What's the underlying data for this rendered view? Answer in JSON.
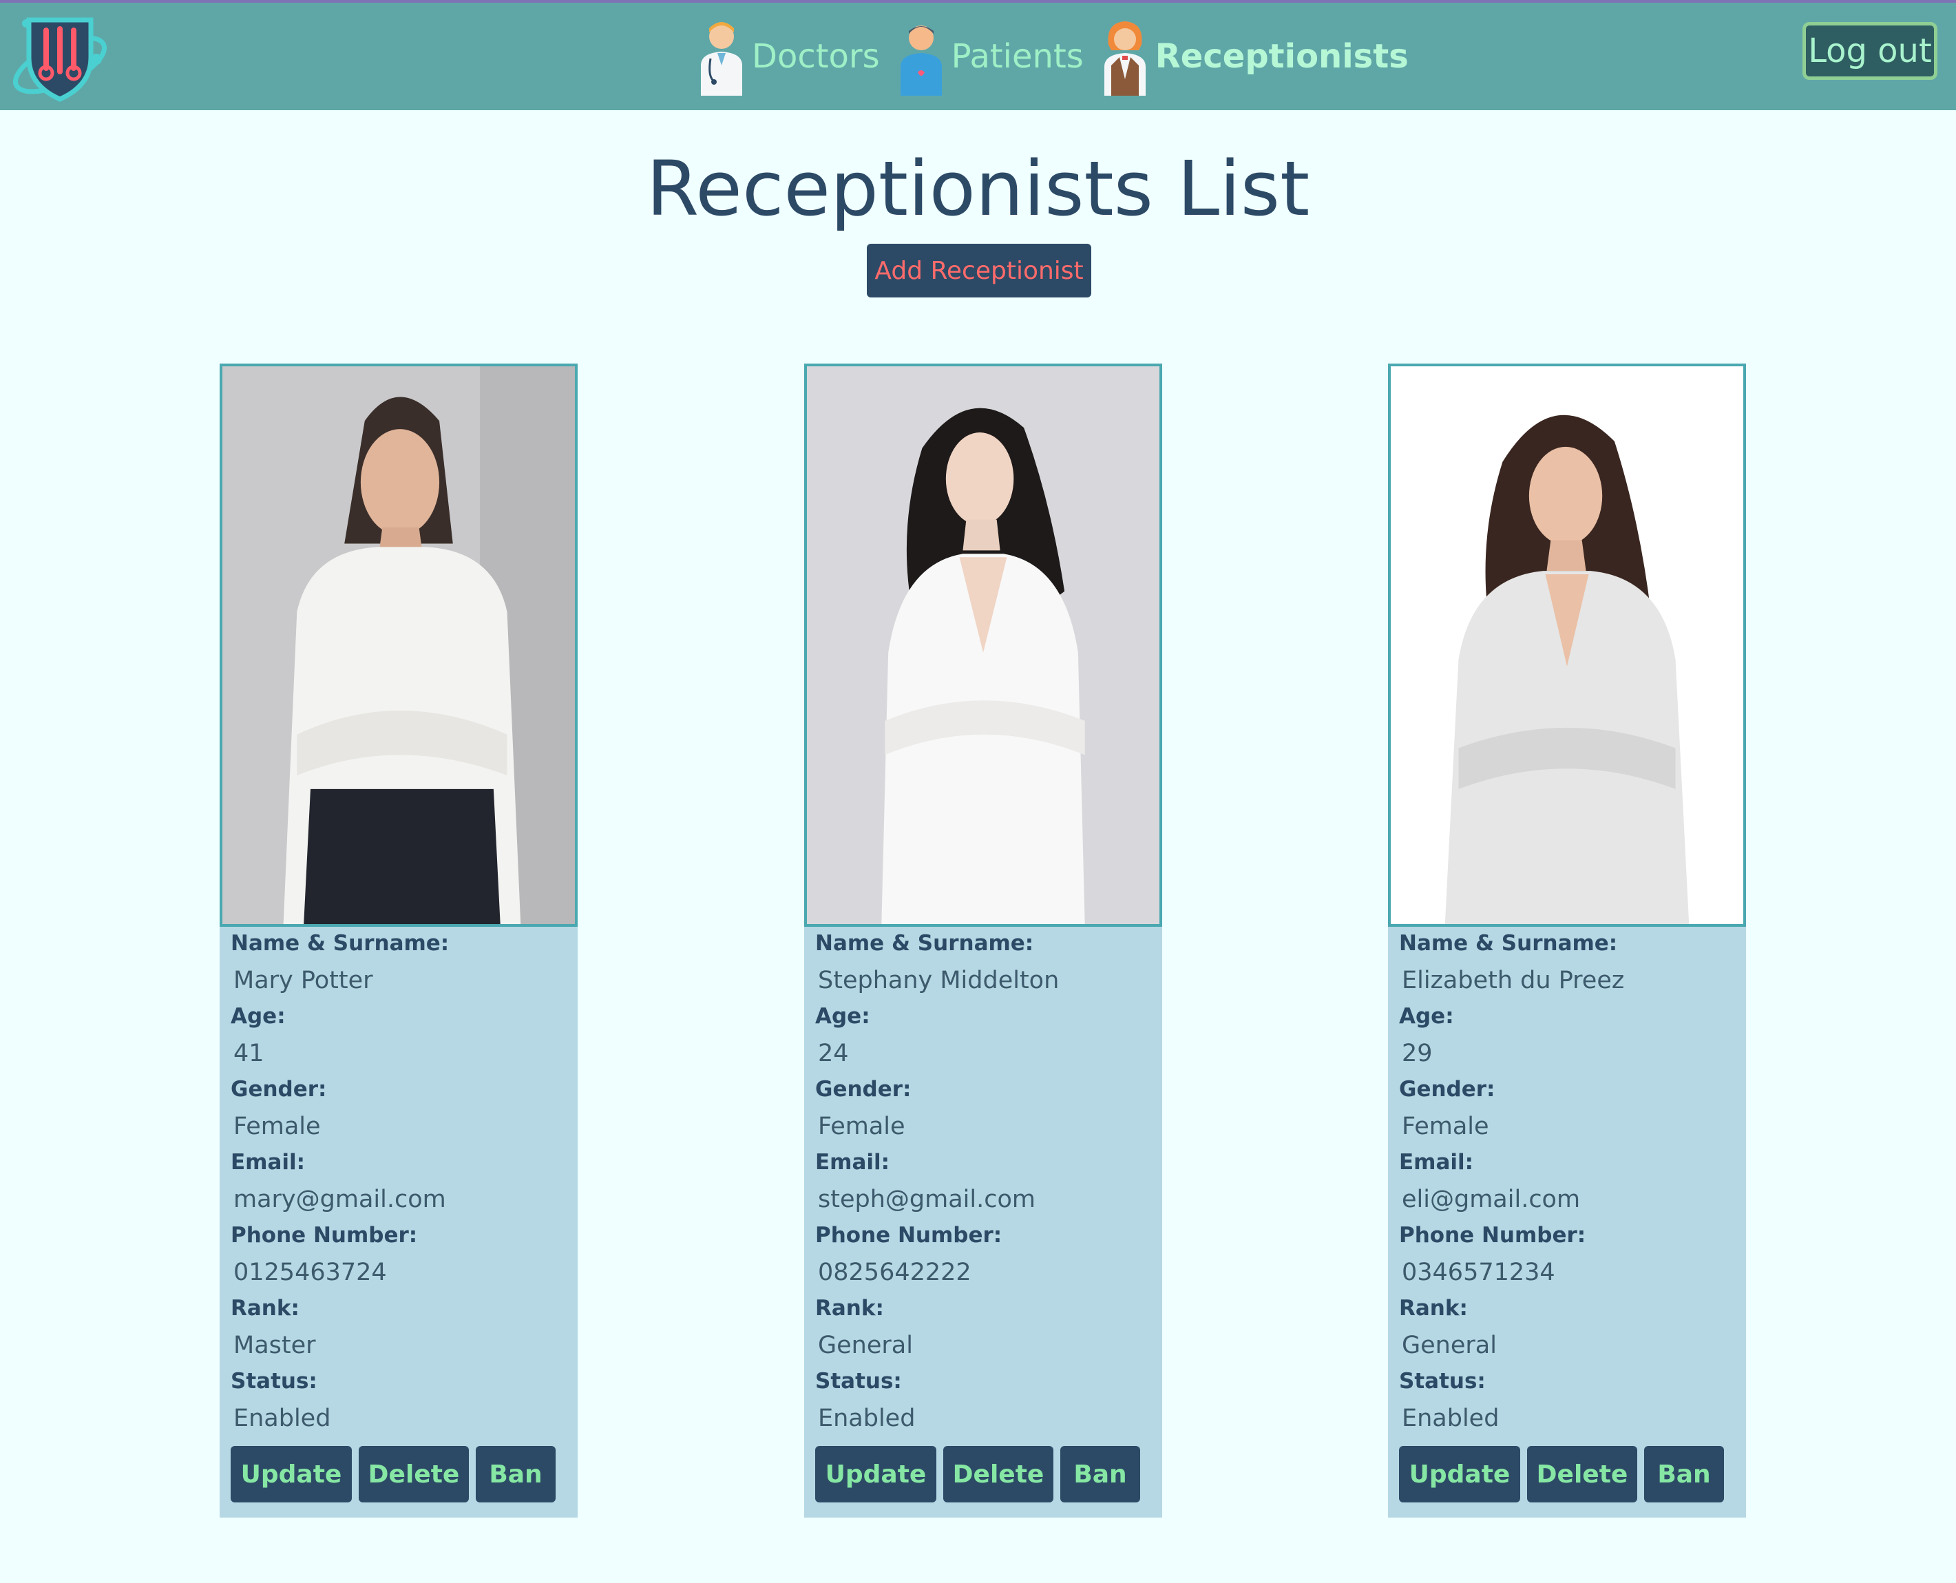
{
  "nav": {
    "logo_icon": "medical-shield-logo-icon",
    "links": [
      {
        "label": "Doctors",
        "icon": "doctor-icon"
      },
      {
        "label": "Patients",
        "icon": "patient-icon"
      },
      {
        "label": "Receptionists",
        "icon": "receptionist-icon"
      }
    ],
    "logout_label": "Log out"
  },
  "page": {
    "title": "Receptionists List",
    "add_button_label": "Add Receptionist"
  },
  "field_labels": {
    "name": "Name & Surname:",
    "age": "Age:",
    "gender": "Gender:",
    "email": "Email:",
    "phone": "Phone Number:",
    "rank": "Rank:",
    "status": "Status:"
  },
  "buttons": {
    "update": "Update",
    "delete": "Delete",
    "ban": "Ban"
  },
  "receptionists": [
    {
      "name": "Mary Potter",
      "age": "41",
      "gender": "Female",
      "email": "mary@gmail.com",
      "phone": "0125463724",
      "rank": "Master",
      "status": "Enabled"
    },
    {
      "name": "Stephany Middelton",
      "age": "24",
      "gender": "Female",
      "email": "steph@gmail.com",
      "phone": "0825642222",
      "rank": "General",
      "status": "Enabled"
    },
    {
      "name": "Elizabeth du Preez",
      "age": "29",
      "gender": "Female",
      "email": "eli@gmail.com",
      "phone": "0346571234",
      "rank": "General",
      "status": "Enabled"
    }
  ],
  "colors": {
    "navbar": "#5fa7a7",
    "page_bg": "#f0ffff",
    "card_bg": "#b6d8e4",
    "button_bg": "#2c4a66",
    "button_text": "#86e6a3",
    "add_button_text": "#ff6b6b"
  }
}
